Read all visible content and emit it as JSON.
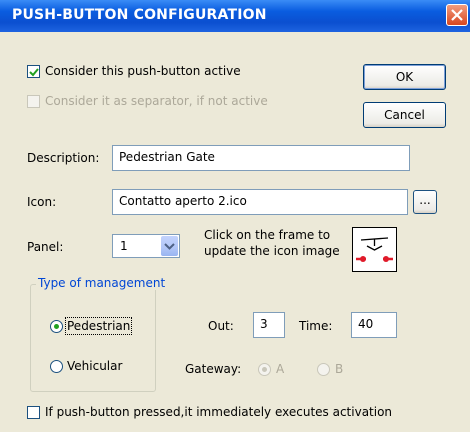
{
  "window": {
    "title": "PUSH-BUTTON CONFIGURATION"
  },
  "options": {
    "active_label": "Consider this push-button active",
    "active_checked": true,
    "separator_label": "Consider it as separator, if not active",
    "separator_checked": false
  },
  "buttons": {
    "ok_label": "OK",
    "cancel_label": "Cancel",
    "browse_label": "..."
  },
  "fields": {
    "description_label": "Description:",
    "description_value": "Pedestrian Gate",
    "icon_label": "Icon:",
    "icon_value": "Contatto aperto 2.ico",
    "panel_label": "Panel:",
    "panel_value": "1",
    "icon_hint": "Click on the frame to update the icon image"
  },
  "management": {
    "title": "Type of management",
    "pedestrian_label": "Pedestrian",
    "vehicular_label": "Vehicular",
    "selected": "Pedestrian"
  },
  "timing": {
    "out_label": "Out:",
    "out_value": "3",
    "time_label": "Time:",
    "time_value": "40",
    "gateway_label": "Gateway:",
    "gateway_a": "A",
    "gateway_b": "B"
  },
  "footer": {
    "immediate_label": "If push-button pressed,it immediately executes activation",
    "immediate_checked": false
  },
  "colors": {
    "accent": "#0046D5",
    "title_bar": "#0B4FD0",
    "window_bg": "#ECE9D8",
    "close_button": "#D8461F"
  }
}
